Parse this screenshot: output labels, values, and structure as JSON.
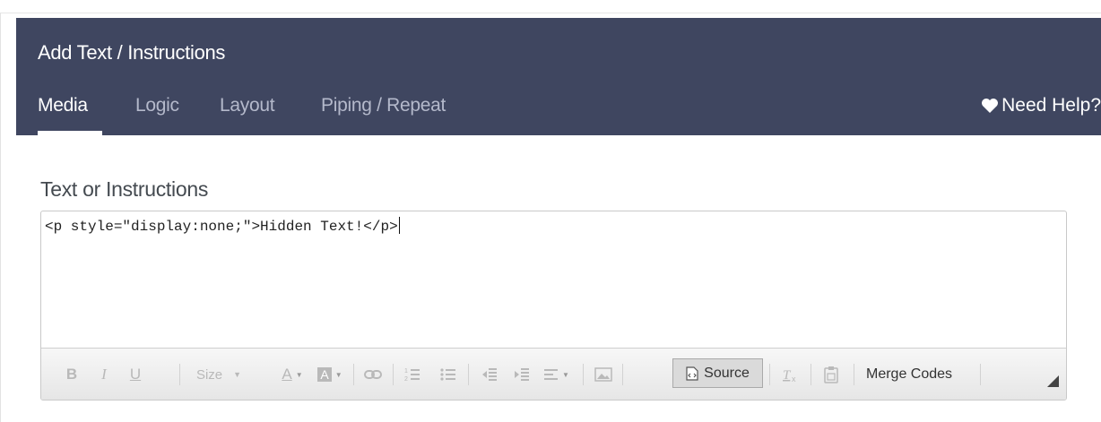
{
  "dialog": {
    "title": "Add Text / Instructions",
    "tabs": [
      {
        "label": "Media",
        "active": true
      },
      {
        "label": "Logic",
        "active": false
      },
      {
        "label": "Layout",
        "active": false
      },
      {
        "label": "Piping / Repeat",
        "active": false
      }
    ],
    "help_label": "Need Help?"
  },
  "field": {
    "label": "Text or Instructions",
    "value": "<p style=\"display:none;\">Hidden Text!</p>"
  },
  "toolbar": {
    "bold": "B",
    "italic": "I",
    "underline": "U",
    "size_label": "Size",
    "font_color_label": "A",
    "bg_color_label": "A",
    "source_label": "Source",
    "merge_codes_label": "Merge Codes"
  },
  "colors": {
    "header_bg": "#3f4660",
    "tab_inactive": "#b4b9cb",
    "source_active_bg": "#dadada"
  }
}
